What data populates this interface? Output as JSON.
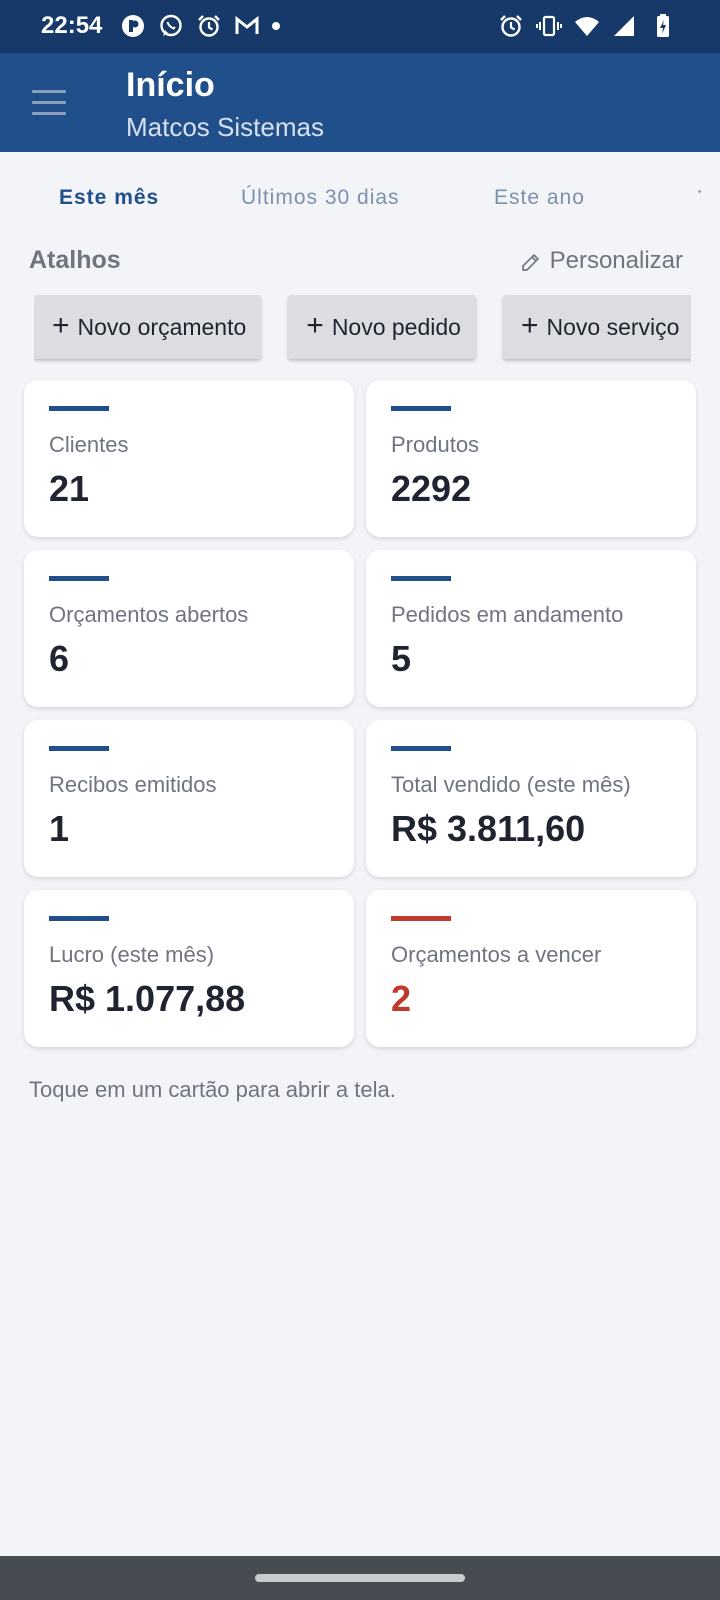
{
  "status_bar": {
    "time": "22:54",
    "left_icons": [
      "app-notification-icon",
      "whatsapp-icon",
      "alarm-icon",
      "gmail-icon",
      "more-notifications-dot-icon"
    ],
    "right_icons": [
      "alarm-icon",
      "vibrate-icon",
      "wifi-icon",
      "signal-icon",
      "battery-charging-icon"
    ]
  },
  "app_bar": {
    "title": "Início",
    "subtitle": "Matcos Sistemas",
    "menu_icon": "hamburger-menu-icon"
  },
  "tabs": [
    {
      "label": "Este mês",
      "active": true
    },
    {
      "label": "Últimos 30 dias",
      "active": false
    },
    {
      "label": "Este ano",
      "active": false
    }
  ],
  "shortcuts": {
    "title": "Atalhos",
    "customize_label": "Personalizar",
    "customize_icon": "pencil-icon",
    "items": [
      {
        "plus": "+",
        "label": "Novo orçamento"
      },
      {
        "plus": "+",
        "label": "Novo pedido"
      },
      {
        "plus": "+",
        "label": "Novo serviço"
      }
    ]
  },
  "cards": [
    {
      "label": "Clientes",
      "value": "21",
      "alert": false
    },
    {
      "label": "Produtos",
      "value": "2292",
      "alert": false
    },
    {
      "label": "Orçamentos abertos",
      "value": "6",
      "alert": false
    },
    {
      "label": "Pedidos em andamento",
      "value": "5",
      "alert": false
    },
    {
      "label": "Recibos emitidos",
      "value": "1",
      "alert": false
    },
    {
      "label": "Total vendido (este mês)",
      "value": "R$ 3.811,60",
      "alert": false
    },
    {
      "label": "Lucro (este mês)",
      "value": "R$ 1.077,88",
      "alert": false
    },
    {
      "label": "Orçamentos a vencer",
      "value": "2",
      "alert": true
    }
  ],
  "hint": "Toque em um cartão para abrir a tela.",
  "colors": {
    "status_bar": "#17396a",
    "app_bar": "#214f8b",
    "accent": "#214f8b",
    "alert": "#c0392b",
    "background": "#f3f4f8"
  }
}
